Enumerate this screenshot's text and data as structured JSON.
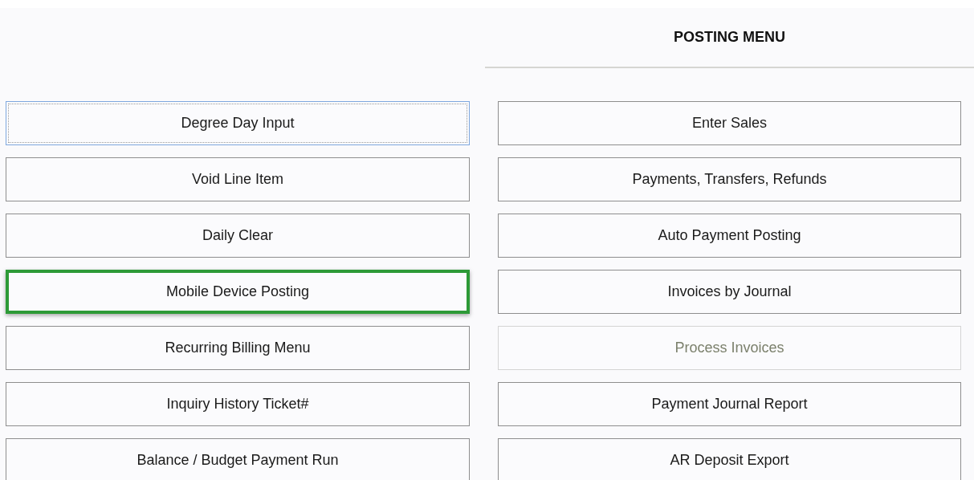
{
  "title": "POSTING MENU",
  "left_buttons": [
    {
      "label": "Degree Day Input",
      "focused": true,
      "highlighted": false
    },
    {
      "label": "Void Line Item",
      "focused": false,
      "highlighted": false
    },
    {
      "label": "Daily Clear",
      "focused": false,
      "highlighted": false
    },
    {
      "label": "Mobile Device Posting",
      "focused": false,
      "highlighted": true
    },
    {
      "label": "Recurring Billing Menu",
      "focused": false,
      "highlighted": false
    },
    {
      "label": "Inquiry History Ticket#",
      "focused": false,
      "highlighted": false
    },
    {
      "label": "Balance / Budget Payment Run",
      "focused": false,
      "highlighted": false
    }
  ],
  "right_buttons": [
    {
      "label": "Enter Sales",
      "disabled": false
    },
    {
      "label": "Payments, Transfers, Refunds",
      "disabled": false
    },
    {
      "label": "Auto Payment Posting",
      "disabled": false
    },
    {
      "label": "Invoices by Journal",
      "disabled": false
    },
    {
      "label": "Process Invoices",
      "disabled": true
    },
    {
      "label": "Payment Journal Report",
      "disabled": false
    },
    {
      "label": "AR Deposit Export",
      "disabled": false
    }
  ]
}
